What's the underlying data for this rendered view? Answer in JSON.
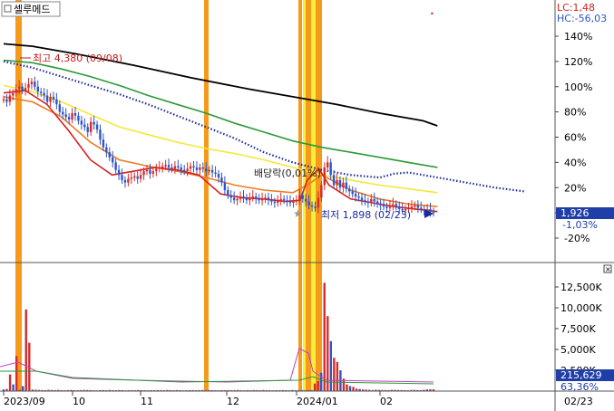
{
  "title": "셀루메드",
  "indicators": {
    "lc": "LC:1,48",
    "hc": "HC:-56,03"
  },
  "price_axis": [
    "140%",
    "120%",
    "100%",
    "80%",
    "60%",
    "40%",
    "20%",
    "0%",
    "-20%"
  ],
  "volume_axis": [
    "12,500K",
    "10,000K",
    "7,500K",
    "5,000K",
    "2,500K"
  ],
  "x_labels": [
    "2023/09",
    "10",
    "11",
    "12",
    "2024/01",
    "02"
  ],
  "right_date": "02/23",
  "annotations": {
    "high": "최고 4,380 (09/08)",
    "low": "최저 1,898 (02/23)",
    "dividend": "배당락(0,01%)"
  },
  "last_price": {
    "value": "1,926",
    "change": "-1,03%"
  },
  "last_volume": {
    "value": "215,629",
    "pct": "63,36%"
  },
  "colors": {
    "up": "#d62b2b",
    "down": "#2f55c8",
    "highlight_orange": "#f59a1a",
    "highlight_yellow": "#f5ef3a",
    "ma_black": "#000000",
    "ma_green": "#2a9a3a",
    "ma_yellow": "#f3e838",
    "ma_orange": "#ee7a22",
    "ma_red": "#d62020",
    "ma_dotted": "#1a2a9a"
  },
  "chart_data": {
    "type": "candlestick",
    "price_change_pct": [
      90,
      88,
      93,
      95,
      98,
      100,
      97,
      99,
      102,
      104,
      100,
      96,
      95,
      93,
      88,
      92,
      90,
      86,
      80,
      78,
      76,
      74,
      79,
      77,
      73,
      70,
      68,
      64,
      72,
      70,
      66,
      58,
      52,
      48,
      44,
      40,
      34,
      30,
      26,
      24,
      27,
      28,
      29,
      27,
      30,
      33,
      34,
      31,
      33,
      35,
      36,
      37,
      38,
      36,
      35,
      37,
      36,
      34,
      33,
      35,
      37,
      36,
      34,
      36,
      35,
      33,
      34,
      32,
      31,
      28,
      24,
      18,
      14,
      12,
      10,
      11,
      13,
      12,
      10,
      12,
      13,
      11,
      10,
      11,
      12,
      10,
      9,
      8,
      10,
      11,
      10,
      9,
      8,
      9,
      10,
      14,
      11,
      9,
      6,
      5,
      4,
      12,
      22,
      36,
      40,
      30,
      22,
      26,
      20,
      24,
      19,
      17,
      15,
      13,
      12,
      10,
      9,
      8,
      11,
      9,
      7,
      6,
      5,
      4,
      6,
      7,
      5,
      3,
      2,
      3,
      4,
      5,
      6,
      4,
      3,
      2,
      3,
      1,
      0
    ],
    "series": [
      {
        "name": "ma_black",
        "values": [
          [
            0,
            134
          ],
          [
            20,
            132
          ],
          [
            50,
            126
          ],
          [
            90,
            117
          ],
          [
            130,
            107
          ],
          [
            170,
            98
          ],
          [
            200,
            92
          ],
          [
            230,
            86
          ],
          [
            260,
            79
          ],
          [
            290,
            73
          ],
          [
            300,
            69
          ]
        ]
      },
      {
        "name": "ma_green",
        "values": [
          [
            0,
            121
          ],
          [
            20,
            119
          ],
          [
            40,
            114
          ],
          [
            60,
            108
          ],
          [
            80,
            101
          ],
          [
            100,
            93
          ],
          [
            120,
            86
          ],
          [
            140,
            79
          ],
          [
            160,
            71
          ],
          [
            180,
            64
          ],
          [
            200,
            57
          ],
          [
            220,
            52
          ],
          [
            240,
            48
          ],
          [
            260,
            44
          ],
          [
            280,
            40
          ],
          [
            300,
            36
          ]
        ]
      },
      {
        "name": "ma_dotted",
        "values": [
          [
            0,
            120
          ],
          [
            20,
            115
          ],
          [
            40,
            108
          ],
          [
            60,
            101
          ],
          [
            80,
            94
          ],
          [
            100,
            86
          ],
          [
            120,
            77
          ],
          [
            140,
            68
          ],
          [
            160,
            59
          ],
          [
            180,
            48
          ],
          [
            200,
            40
          ],
          [
            220,
            34
          ],
          [
            240,
            30
          ],
          [
            260,
            28
          ],
          [
            270,
            31
          ],
          [
            280,
            32
          ],
          [
            290,
            30
          ],
          [
            300,
            28
          ],
          [
            320,
            24
          ],
          [
            340,
            20
          ],
          [
            360,
            17
          ]
        ]
      },
      {
        "name": "ma_yellow",
        "values": [
          [
            0,
            101
          ],
          [
            20,
            96
          ],
          [
            40,
            88
          ],
          [
            60,
            78
          ],
          [
            80,
            68
          ],
          [
            100,
            62
          ],
          [
            120,
            56
          ],
          [
            140,
            51
          ],
          [
            160,
            47
          ],
          [
            180,
            42
          ],
          [
            200,
            36
          ],
          [
            220,
            30
          ],
          [
            240,
            26
          ],
          [
            260,
            22
          ],
          [
            280,
            19
          ],
          [
            300,
            16
          ]
        ]
      },
      {
        "name": "ma_orange",
        "values": [
          [
            0,
            92
          ],
          [
            20,
            88
          ],
          [
            40,
            76
          ],
          [
            60,
            56
          ],
          [
            80,
            42
          ],
          [
            100,
            37
          ],
          [
            120,
            33
          ],
          [
            140,
            28
          ],
          [
            160,
            22
          ],
          [
            180,
            18
          ],
          [
            200,
            16
          ],
          [
            210,
            22
          ],
          [
            220,
            30
          ],
          [
            240,
            18
          ],
          [
            260,
            11
          ],
          [
            280,
            7
          ],
          [
            300,
            5
          ]
        ]
      },
      {
        "name": "ma_red",
        "values": [
          [
            0,
            95
          ],
          [
            15,
            97
          ],
          [
            30,
            86
          ],
          [
            45,
            65
          ],
          [
            60,
            42
          ],
          [
            75,
            30
          ],
          [
            90,
            33
          ],
          [
            105,
            36
          ],
          [
            120,
            34
          ],
          [
            135,
            30
          ],
          [
            150,
            15
          ],
          [
            165,
            12
          ],
          [
            180,
            11
          ],
          [
            195,
            9
          ],
          [
            205,
            10
          ],
          [
            210,
            26
          ],
          [
            218,
            35
          ],
          [
            225,
            22
          ],
          [
            240,
            11
          ],
          [
            255,
            8
          ],
          [
            270,
            5
          ],
          [
            285,
            3
          ],
          [
            300,
            1
          ]
        ]
      }
    ],
    "volume_k": [
      200,
      250,
      2000,
      800,
      4200,
      150,
      600,
      9800,
      5800,
      180,
      160,
      140,
      120,
      110,
      150,
      130,
      120,
      140,
      110,
      100,
      120,
      130,
      110,
      100,
      120,
      140,
      130,
      120,
      100,
      90,
      110,
      120,
      100,
      130,
      110,
      100,
      120,
      110,
      90,
      100,
      110,
      100,
      120,
      110,
      100,
      90,
      110,
      100,
      120,
      110,
      100,
      130,
      110,
      100,
      120,
      110,
      90,
      100,
      110,
      120,
      100,
      110,
      130,
      100,
      120,
      110,
      100,
      90,
      110,
      100,
      120,
      100,
      110,
      130,
      100,
      90,
      110,
      100,
      120,
      110,
      100,
      130,
      110,
      100,
      90,
      110,
      100,
      120,
      110,
      100,
      130,
      100,
      110,
      120,
      100,
      120,
      130,
      900,
      1200,
      2200,
      13000,
      9000,
      6000,
      4000,
      3500,
      2500,
      1500,
      800,
      600,
      500,
      300,
      250,
      200,
      180,
      150,
      120,
      160,
      140,
      130,
      120,
      110,
      150,
      140,
      130,
      120,
      110,
      100,
      130,
      140,
      120,
      110,
      150,
      200,
      216,
      215
    ],
    "highlight_bands": [
      {
        "color": "orange",
        "index": 9
      },
      {
        "color": "orange",
        "index": 106
      },
      {
        "color": "orange",
        "index": 160
      },
      {
        "color": "yellow",
        "index": 162
      },
      {
        "color": "orange",
        "index": 166
      },
      {
        "color": "yellow",
        "index": 168
      },
      {
        "color": "orange",
        "index": 172
      }
    ]
  }
}
